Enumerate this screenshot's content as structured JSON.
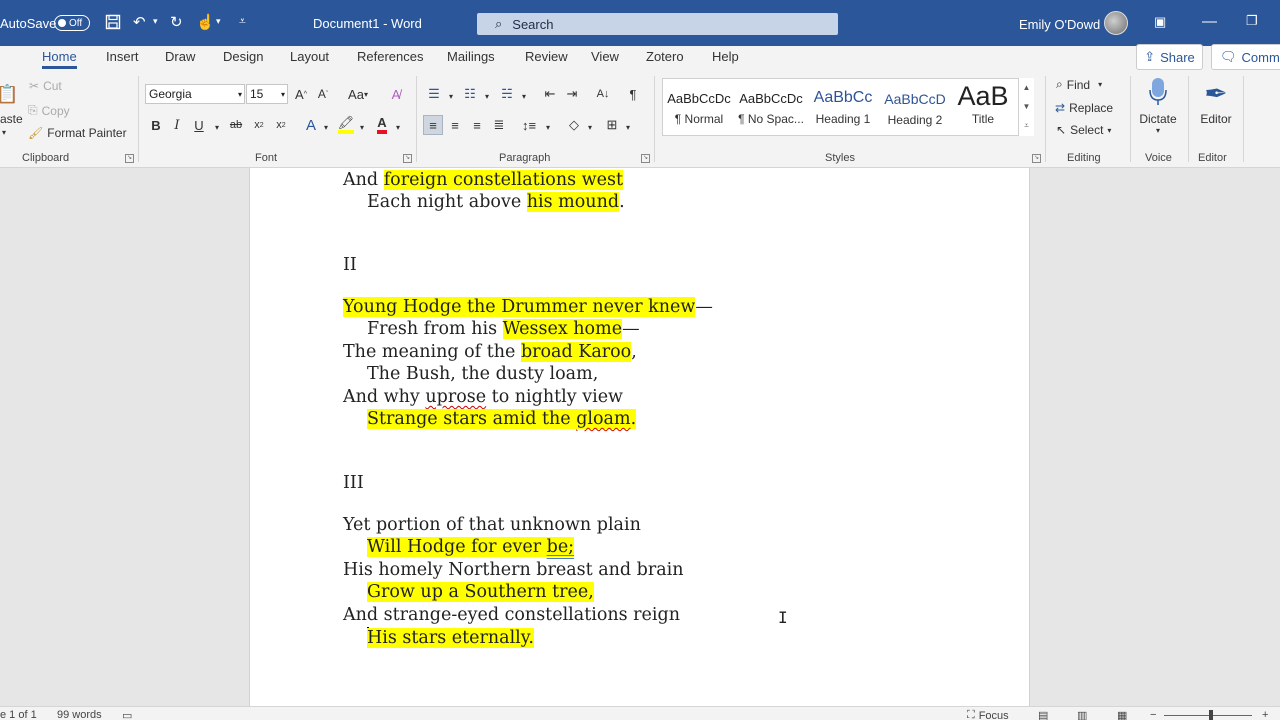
{
  "titlebar": {
    "autosave_label": "AutoSave",
    "autosave_state": "Off",
    "document_title": "Document1  -  Word",
    "search_placeholder": "Search",
    "user_name": "Emily O'Dowd"
  },
  "tabs": [
    "Home",
    "Insert",
    "Draw",
    "Design",
    "Layout",
    "References",
    "Mailings",
    "Review",
    "View",
    "Zotero",
    "Help"
  ],
  "active_tab": "Home",
  "share_label": "Share",
  "comments_label": "Comme",
  "clipboard": {
    "paste_label": "aste",
    "cut_label": "Cut",
    "copy_label": "Copy",
    "format_painter_label": "Format Painter",
    "group_label": "Clipboard"
  },
  "font": {
    "family": "Georgia",
    "size": "15",
    "group_label": "Font"
  },
  "paragraph": {
    "group_label": "Paragraph"
  },
  "styles": {
    "group_label": "Styles",
    "items": [
      {
        "sample": "AaBbCcDc",
        "name": "¶ Normal"
      },
      {
        "sample": "AaBbCcDc",
        "name": "¶ No Spac..."
      },
      {
        "sample": "AaBbCc",
        "name": "Heading 1"
      },
      {
        "sample": "AaBbCcD",
        "name": "Heading 2"
      },
      {
        "sample": "AaB",
        "name": "Title"
      }
    ]
  },
  "editing": {
    "find_label": "Find",
    "replace_label": "Replace",
    "select_label": "Select",
    "group_label": "Editing"
  },
  "voice": {
    "dictate_label": "Dictate",
    "group_label": "Voice"
  },
  "editor": {
    "editor_label": "Editor",
    "group_label": "Editor"
  },
  "document": {
    "lines": [
      {
        "parts": [
          {
            "t": "And "
          },
          {
            "t": "foreign constellations west",
            "hl": true
          }
        ]
      },
      {
        "parts": [
          {
            "t": "Each night above "
          },
          {
            "t": "his mound",
            "hl": true
          },
          {
            "t": "."
          }
        ]
      },
      {
        "parts": [
          {
            "t": "II"
          }
        ]
      },
      {
        "parts": [
          {
            "t": "Young Hodge the Drummer never knew",
            "hl": true
          },
          {
            "t": "—"
          }
        ]
      },
      {
        "parts": [
          {
            "t": "Fresh from his "
          },
          {
            "t": "Wessex home",
            "hl": true
          },
          {
            "t": "—"
          }
        ]
      },
      {
        "parts": [
          {
            "t": "The meaning of the "
          },
          {
            "t": "broad Karoo",
            "hl": true
          },
          {
            "t": ","
          }
        ]
      },
      {
        "parts": [
          {
            "t": "The Bush, the dusty loam,"
          }
        ]
      },
      {
        "parts": [
          {
            "t": "And why "
          },
          {
            "t": "uprose",
            "sq": true
          },
          {
            "t": " to nightly view"
          }
        ]
      },
      {
        "parts": [
          {
            "t": "Strange stars amid the ",
            "hl": true
          },
          {
            "t": "gloam",
            "hl": true,
            "sq": true
          },
          {
            "t": ".",
            "hl": true
          }
        ]
      },
      {
        "parts": [
          {
            "t": "III"
          }
        ]
      },
      {
        "parts": [
          {
            "t": "Yet portion of that unknown plain"
          }
        ]
      },
      {
        "parts": [
          {
            "t": "Will Hodge for ever ",
            "hl": true
          },
          {
            "t": "be;",
            "hl": true,
            "dq": true
          }
        ]
      },
      {
        "parts": [
          {
            "t": "His homely Northern breast and brain"
          }
        ]
      },
      {
        "parts": [
          {
            "t": "Grow up a Southern tree,",
            "hl": true
          }
        ]
      },
      {
        "parts": [
          {
            "t": "And strange-eyed constellations reign"
          }
        ]
      },
      {
        "parts": [
          {
            "t": "His stars eternally.",
            "hl": true
          }
        ]
      }
    ]
  },
  "statusbar": {
    "page_label": "e 1 of 1",
    "words_label": "99 words",
    "focus_label": "Focus"
  }
}
